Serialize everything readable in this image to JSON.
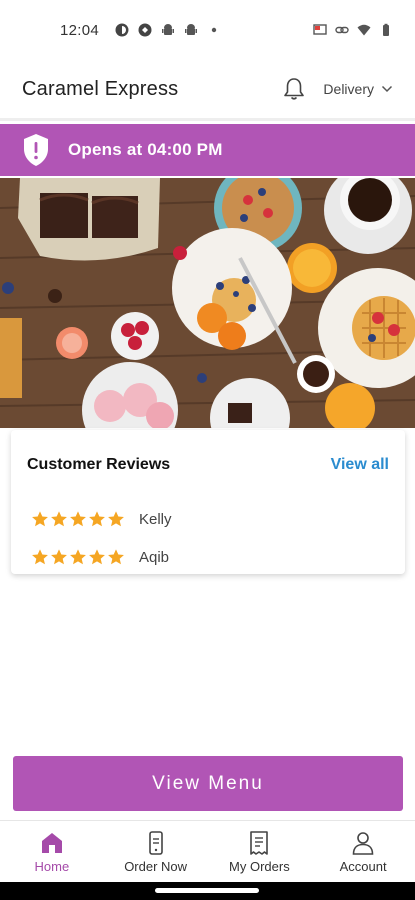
{
  "status_bar": {
    "time": "12:04",
    "left_icons": [
      "app-notification-icon",
      "sync-icon",
      "android-icon",
      "android-icon",
      "dot-icon"
    ],
    "right_icons": [
      "cast-icon",
      "link-icon",
      "wifi-icon",
      "battery-icon"
    ]
  },
  "header": {
    "title": "Caramel Express",
    "delivery_label": "Delivery"
  },
  "banner": {
    "text": "Opens at 04:00 PM"
  },
  "reviews": {
    "title": "Customer Reviews",
    "view_all": "View all",
    "items": [
      {
        "name": "Kelly",
        "rating": 5
      },
      {
        "name": "Aqib",
        "rating": 5
      }
    ]
  },
  "view_menu_label": "View Menu",
  "bottom_nav": {
    "items": [
      {
        "label": "Home",
        "icon": "home-icon",
        "active": true
      },
      {
        "label": "Order Now",
        "icon": "phone-order-icon",
        "active": false
      },
      {
        "label": "My Orders",
        "icon": "receipt-icon",
        "active": false
      },
      {
        "label": "Account",
        "icon": "person-icon",
        "active": false
      }
    ]
  },
  "colors": {
    "brand": "#b155b5",
    "link": "#2b8ccf",
    "star": "#f5a623",
    "active_nav": "#a54aa9"
  }
}
